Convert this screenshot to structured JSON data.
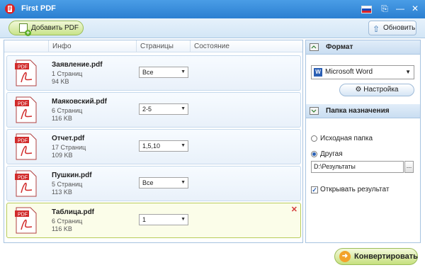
{
  "app": {
    "title": "First PDF"
  },
  "toolbar": {
    "add_pdf_label": "Добавить PDF",
    "refresh_label": "Обновить"
  },
  "columns": {
    "info": "Инфо",
    "pages": "Страницы",
    "status": "Состояние"
  },
  "files": [
    {
      "name": "Заявление.pdf",
      "pages": "1 Страниц",
      "size": "94 KB",
      "range": "Все",
      "selected": false
    },
    {
      "name": "Маяковский.pdf",
      "pages": "6 Страниц",
      "size": "116 KB",
      "range": "2-5",
      "selected": false
    },
    {
      "name": "Отчет.pdf",
      "pages": "17 Страниц",
      "size": "109 KB",
      "range": "1,5,10",
      "selected": false
    },
    {
      "name": "Пушкин.pdf",
      "pages": "5 Страниц",
      "size": "113 KB",
      "range": "Все",
      "selected": false
    },
    {
      "name": "Таблица.pdf",
      "pages": "6 Страниц",
      "size": "116 KB",
      "range": "1",
      "selected": true
    }
  ],
  "format_section": {
    "title": "Формат",
    "selected_format": "Microsoft Word",
    "settings_label": "Настройка"
  },
  "destination_section": {
    "title": "Папка назначения",
    "option_source": "Исходная папка",
    "option_other": "Другая",
    "path": "D:\\Результаты",
    "browse_label": "...",
    "open_result_label": "Открывать результат"
  },
  "convert_label": "Конвертировать",
  "icons": {
    "app": "app-logo-icon",
    "add": "add-pdf-icon",
    "refresh": "refresh-icon",
    "pdf": "pdf-file-icon",
    "settings": "gear-icon",
    "convert": "convert-icon"
  },
  "colors": {
    "titlebar": "#2b7fd1",
    "accent_green": "#c8e38a",
    "panel_border": "#a7c3e0",
    "close_red": "#d43a3a"
  }
}
